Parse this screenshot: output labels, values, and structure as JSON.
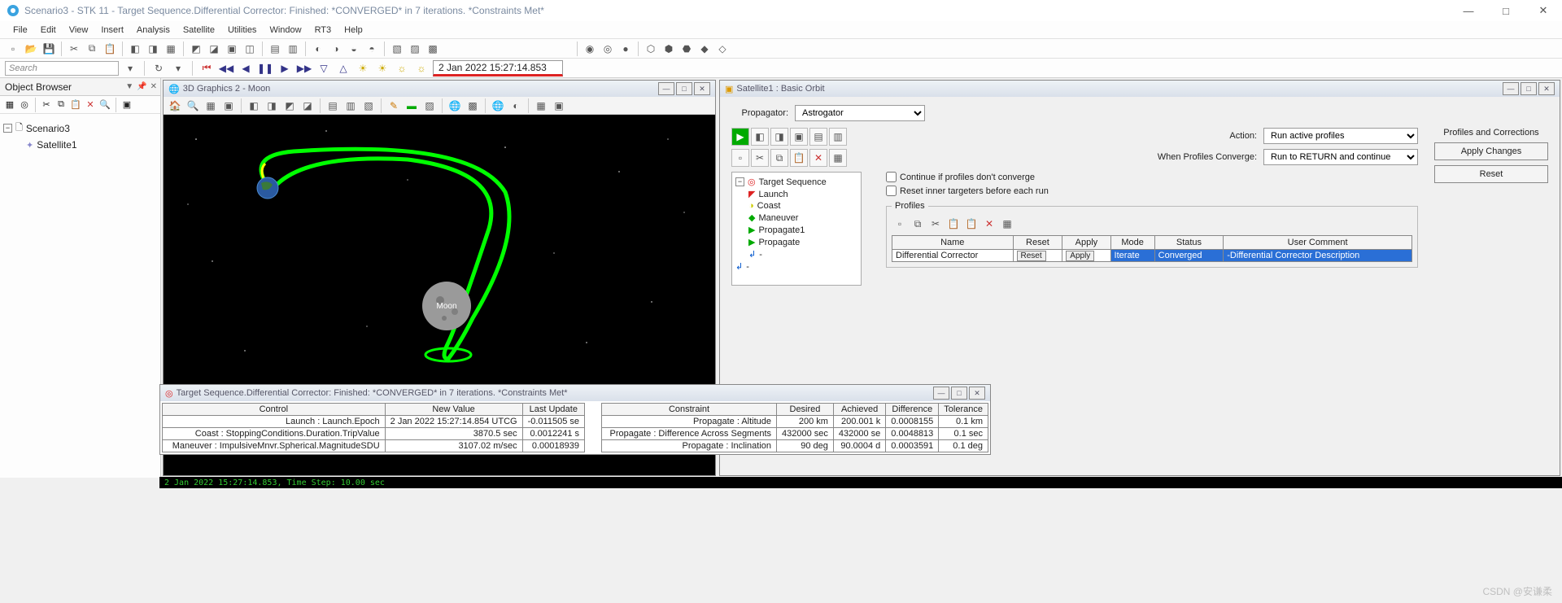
{
  "title": "Scenario3 - STK 11 - Target Sequence.Differential Corrector: Finished:  *CONVERGED* in 7 iterations. *Constraints Met*",
  "menu": [
    "File",
    "Edit",
    "View",
    "Insert",
    "Analysis",
    "Satellite",
    "Utilities",
    "Window",
    "RT3",
    "Help"
  ],
  "time_display": "2 Jan 2022 15:27:14.853",
  "search_placeholder": "Search",
  "object_browser": {
    "title": "Object Browser",
    "root": "Scenario3",
    "child": "Satellite1"
  },
  "viewport": {
    "title": "3D Graphics 2 - Moon",
    "moon_label": "Moon"
  },
  "orbit": {
    "title": "Satellite1 : Basic Orbit",
    "propagator_label": "Propagator:",
    "propagator_value": "Astrogator",
    "action_label": "Action:",
    "action_value": "Run active profiles",
    "converge_label": "When Profiles Converge:",
    "converge_value": "Run to RETURN and continue",
    "chk1": "Continue if profiles don't converge",
    "chk2": "Reset inner targeters before each run",
    "corrections_hdr": "Profiles and Corrections",
    "apply_changes": "Apply Changes",
    "reset": "Reset",
    "profiles_legend": "Profiles",
    "segments": [
      "Target Sequence",
      "Launch",
      "Coast",
      "Maneuver",
      "Propagate1",
      "Propagate",
      "-"
    ],
    "profile_headers": [
      "Name",
      "Reset",
      "Apply",
      "Mode",
      "Status",
      "User Comment"
    ],
    "profile_row": {
      "name": "Differential Corrector",
      "reset": "Reset",
      "apply": "Apply",
      "mode": "Iterate",
      "status": "Converged",
      "comment": "-Differential Corrector Description"
    }
  },
  "seq": {
    "title": "Target Sequence.Differential Corrector: Finished:  *CONVERGED* in 7 iterations. *Constraints Met*",
    "left_headers": [
      "Control",
      "New Value",
      "Last Update"
    ],
    "left_rows": [
      [
        "Launch : Launch.Epoch",
        "2 Jan 2022 15:27:14.854 UTCG",
        "-0.011505 se"
      ],
      [
        "Coast : StoppingConditions.Duration.TripValue",
        "3870.5 sec",
        "0.0012241 s"
      ],
      [
        "Maneuver : ImpulsiveMnvr.Spherical.MagnitudeSDU",
        "3107.02 m/sec",
        "0.00018939"
      ]
    ],
    "right_headers": [
      "Constraint",
      "Desired",
      "Achieved",
      "Difference",
      "Tolerance"
    ],
    "right_rows": [
      [
        "Propagate : Altitude",
        "200   km",
        "200.001 k",
        "0.0008155",
        "0.1   km"
      ],
      [
        "Propagate : Difference Across Segments",
        "432000  sec",
        "432000 se",
        "0.0048813",
        "0.1   sec"
      ],
      [
        "Propagate : Inclination",
        "90    deg",
        "90.0004 d",
        "0.0003591",
        "0.1   deg"
      ]
    ]
  },
  "console": "2 Jan 2022 15:27:14.853,    Time Step: 10.00 sec",
  "watermark": "CSDN @安谦柔"
}
